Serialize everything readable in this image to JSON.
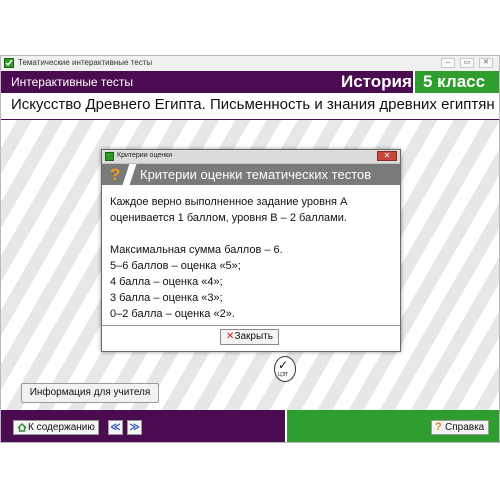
{
  "window": {
    "title": "Тематические интерактивные тесты"
  },
  "header": {
    "section": "Интерактивные тесты",
    "subject": "История",
    "grade": "5 класс"
  },
  "lesson": {
    "title": "Искусство Древнего Египта. Письменность и знания древних египтян"
  },
  "dialog": {
    "window_title": "Критерии оценки",
    "heading": "Критерии оценки тематических тестов",
    "lines": [
      " Каждое верно выполненное задание уровня А",
      "оценивается 1 баллом, уровня В – 2 баллами.",
      "",
      "Максимальная сумма баллов – 6.",
      "5–6 баллов – оценка «5»;",
      "4 балла – оценка «4»;",
      "3 балла – оценка «3»;",
      "0–2 балла – оценка «2»."
    ],
    "close_label": "Закрыть"
  },
  "teacher_info_label": "Информация для учителя",
  "footer": {
    "toc_label": "К содержанию",
    "help_label": "Справка",
    "logo_text": "ЦЭТ"
  },
  "colors": {
    "header_purple": "#4b0b50",
    "grade_green": "#2e9e2e",
    "dialog_header_gray": "#7a7a7a",
    "question_orange": "#f59b14"
  },
  "icons": [
    "app-icon",
    "minimize-icon",
    "maximize-icon",
    "close-icon",
    "home-icon",
    "prev-icon",
    "next-icon",
    "help-icon",
    "question-icon",
    "cet-logo-icon"
  ]
}
